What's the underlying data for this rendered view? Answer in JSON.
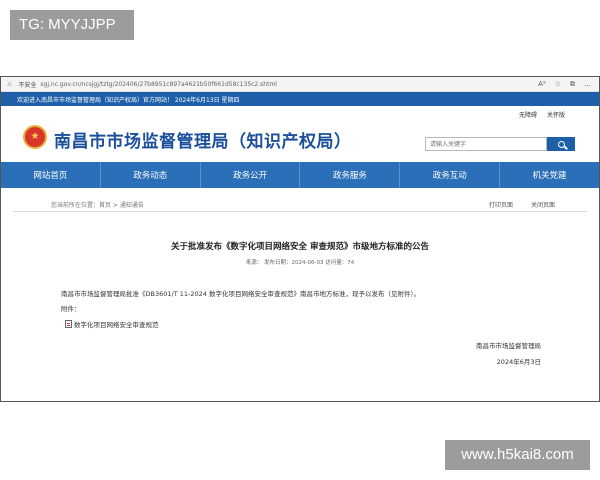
{
  "watermarks": {
    "top_left": "TG: MYYJJPP",
    "bottom_right": "www.h5kai8.com"
  },
  "browser": {
    "security": "不安全",
    "url": "sgj.nc.gov.cn/ncsjgj/tztg/202406/27b8951c897a4621b50f661d58c135c2.shtml",
    "tool_icons": [
      "A⁹",
      "☆",
      "⧉",
      "…"
    ]
  },
  "site": {
    "topbar_text": "欢迎进入南昌市市场监督管理局（知识产权局）官方网站！ 2024年6月13日 星期四",
    "top_links": [
      "无障碍",
      "关怀版"
    ],
    "title": "南昌市市场监督管理局（知识产权局）",
    "search_placeholder": "请输入关键字",
    "nav": [
      "网站首页",
      "政务动态",
      "政务公开",
      "政务服务",
      "政务互动",
      "机关党建"
    ]
  },
  "article": {
    "breadcrumb": "您当前所在位置：首页 > 通知通告",
    "actions": [
      "打印页面",
      "关闭页面"
    ],
    "title": "关于批准发布《数字化项目网络安全 审查规范》市级地方标准的公告",
    "meta": "来源：   发布日期：2024-06-03   访问量：74",
    "paragraph": "南昌市市场监督管理局批准《DB3601/T 11-2024 数字化项目网络安全审查规范》南昌市地方标准，现予以发布（见附件）。",
    "attachment_label": "附件：",
    "attachment_name": "数字化项目网络安全审查规范",
    "signature": "南昌市市场监督管理局",
    "date": "2024年6月3日"
  },
  "colors": {
    "brand_blue": "#1d5fa8",
    "nav_blue": "#2a6fb8",
    "title_blue": "#1b4f9c"
  }
}
